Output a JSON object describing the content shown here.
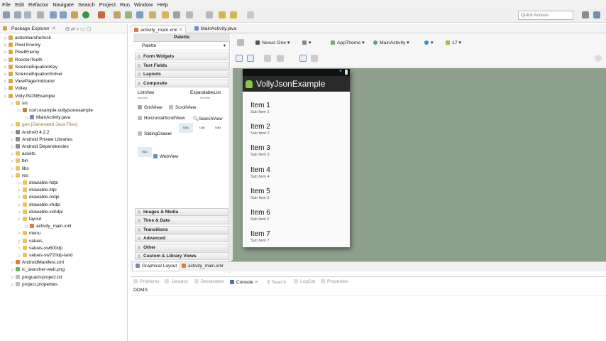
{
  "menu": [
    "File",
    "Edit",
    "Refactor",
    "Navigate",
    "Search",
    "Project",
    "Run",
    "Window",
    "Help"
  ],
  "quick_access": {
    "placeholder": "Quick Access"
  },
  "package_explorer": {
    "title": "Package Explorer",
    "items": [
      {
        "label": "actionbarsherlock",
        "depth": 0,
        "icon": "project-icon"
      },
      {
        "label": "Pixel Enemy",
        "depth": 0,
        "icon": "project-icon"
      },
      {
        "label": "PixelEnemy",
        "depth": 0,
        "icon": "project-icon"
      },
      {
        "label": "RoosterTeeth",
        "depth": 0,
        "icon": "project-icon"
      },
      {
        "label": "ScienceEquationKey",
        "depth": 0,
        "icon": "project-icon"
      },
      {
        "label": "ScienceEquationSolver",
        "depth": 0,
        "icon": "project-icon"
      },
      {
        "label": "ViewPagerIndicator",
        "depth": 0,
        "icon": "project-icon"
      },
      {
        "label": "Volley",
        "depth": 0,
        "icon": "project-icon"
      },
      {
        "label": "VollyJSONExample",
        "depth": 0,
        "icon": "project-icon"
      },
      {
        "label": "src",
        "depth": 1,
        "icon": "folder-icon"
      },
      {
        "label": "com.example.vollyjsonexample",
        "depth": 2,
        "icon": "package-icon"
      },
      {
        "label": "MainActivity.java",
        "depth": 3,
        "icon": "java-file-icon"
      },
      {
        "label": "gen [Generated Java Files]",
        "depth": 1,
        "icon": "folder-icon"
      },
      {
        "label": "Android 4.2.2",
        "depth": 1,
        "icon": "library-icon"
      },
      {
        "label": "Android Private Libraries",
        "depth": 1,
        "icon": "library-icon"
      },
      {
        "label": "Android Dependencies",
        "depth": 1,
        "icon": "library-icon"
      },
      {
        "label": "assets",
        "depth": 1,
        "icon": "folder-icon"
      },
      {
        "label": "bin",
        "depth": 1,
        "icon": "folder-icon"
      },
      {
        "label": "libs",
        "depth": 1,
        "icon": "folder-icon"
      },
      {
        "label": "res",
        "depth": 1,
        "icon": "folder-icon"
      },
      {
        "label": "drawable-hdpi",
        "depth": 2,
        "icon": "folder-icon"
      },
      {
        "label": "drawable-ldpi",
        "depth": 2,
        "icon": "folder-icon"
      },
      {
        "label": "drawable-mdpi",
        "depth": 2,
        "icon": "folder-icon"
      },
      {
        "label": "drawable-xhdpi",
        "depth": 2,
        "icon": "folder-icon"
      },
      {
        "label": "drawable-xxhdpi",
        "depth": 2,
        "icon": "folder-icon"
      },
      {
        "label": "layout",
        "depth": 2,
        "icon": "folder-icon"
      },
      {
        "label": "activity_main.xml",
        "depth": 3,
        "icon": "xml-file-icon"
      },
      {
        "label": "menu",
        "depth": 2,
        "icon": "folder-icon"
      },
      {
        "label": "values",
        "depth": 2,
        "icon": "folder-icon"
      },
      {
        "label": "values-sw600dp",
        "depth": 2,
        "icon": "folder-icon"
      },
      {
        "label": "values-sw720dp-land",
        "depth": 2,
        "icon": "folder-icon"
      },
      {
        "label": "AndroidManifest.xml",
        "depth": 1,
        "icon": "xml-file-icon"
      },
      {
        "label": "ic_launcher-web.png",
        "depth": 1,
        "icon": "image-file-icon"
      },
      {
        "label": "proguard-project.txt",
        "depth": 1,
        "icon": "text-file-icon"
      },
      {
        "label": "project.properties",
        "depth": 1,
        "icon": "text-file-icon"
      }
    ]
  },
  "editor_tabs": [
    "activity_main.xml",
    "MainActivity.java"
  ],
  "palette": {
    "title": "Palette",
    "dropdown": "Palette",
    "categories_top": [
      "Form Widgets",
      "Text Fields",
      "Layouts",
      "Composite"
    ],
    "categories_bottom": [
      "Images & Media",
      "Time & Date",
      "Transitions",
      "Advanced",
      "Other",
      "Custom & Library Views"
    ],
    "listview": "ListView",
    "expandable": "ExpandableList",
    "sub_item": "Sub Item",
    "gridview": "GridView",
    "scrollview": "ScrollView",
    "hscroll": "HorizontalScrollView",
    "searchview": "SearchView",
    "sliding": "SlidingDrawer",
    "tabs": [
      "TAB1",
      "TAB2",
      "TAB3"
    ],
    "tab1": "TAB1",
    "webview": "WebView"
  },
  "layout_toolbar": {
    "device": "Nexus One",
    "theme": "AppTheme",
    "activity": "MainActivity",
    "api": "17"
  },
  "preview": {
    "app_title": "VollyJsonExample",
    "items": [
      {
        "title": "Item 1",
        "sub": "Sub Item 1"
      },
      {
        "title": "Item 2",
        "sub": "Sub Item 2"
      },
      {
        "title": "Item 3",
        "sub": "Sub Item 3"
      },
      {
        "title": "Item 4",
        "sub": "Sub Item 4"
      },
      {
        "title": "Item 5",
        "sub": "Sub Item 5"
      },
      {
        "title": "Item 6",
        "sub": "Sub Item 6"
      },
      {
        "title": "Item 7",
        "sub": "Sub Item 7"
      }
    ]
  },
  "editor_bottom_tabs": [
    "Graphical Layout",
    "activity_main.xml"
  ],
  "console": {
    "tabs": [
      "Problems",
      "Javadoc",
      "Declaration",
      "Console",
      "Search",
      "LogCat",
      "Properties"
    ],
    "active": "Console",
    "content": "DDMS"
  },
  "colors": {
    "canvas": "#8da08c",
    "actionbar": "#2a2a2a",
    "droid": "#8dc63f"
  }
}
